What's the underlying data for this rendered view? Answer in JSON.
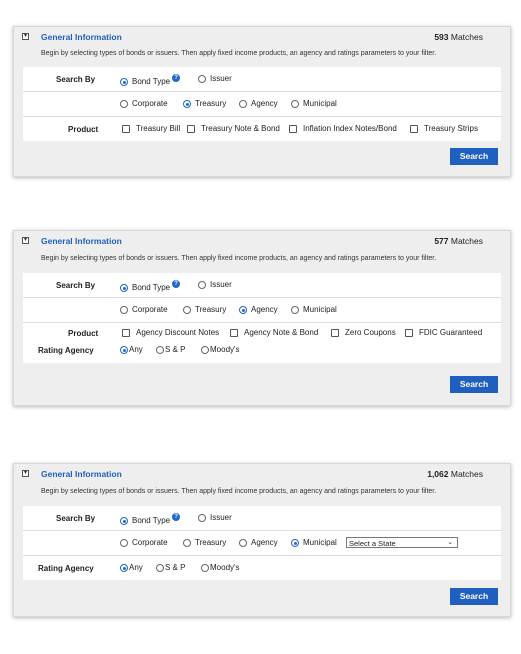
{
  "panels": [
    {
      "title": "General Information",
      "matches_count": "593",
      "matches_label": "Matches",
      "description": "Begin by selecting types of bonds or issuers. Then apply fixed income products, an agency and ratings parameters to your filter.",
      "search_by_label": "Search By",
      "search_by_options": [
        "Bond Type",
        "Issuer"
      ],
      "search_by_selected": "Bond Type",
      "help_icon": "?",
      "type_options": [
        "Corporate",
        "Treasury",
        "Agency",
        "Municipal"
      ],
      "type_selected": "Treasury",
      "product_label": "Product",
      "products": [
        "Treasury Bill",
        "Treasury Note & Bond",
        "Inflation Index Notes/Bond",
        "Treasury Strips"
      ],
      "search_button": "Search"
    },
    {
      "title": "General Information",
      "matches_count": "577",
      "matches_label": "Matches",
      "description": "Begin by selecting types of bonds or issuers. Then apply fixed income products, an agency and ratings parameters to your filter.",
      "search_by_label": "Search By",
      "search_by_options": [
        "Bond Type",
        "Issuer"
      ],
      "search_by_selected": "Bond Type",
      "help_icon": "?",
      "type_options": [
        "Corporate",
        "Treasury",
        "Agency",
        "Municipal"
      ],
      "type_selected": "Agency",
      "product_label": "Product",
      "products": [
        "Agency Discount Notes",
        "Agency Note & Bond",
        "Zero Coupons",
        "FDIC Guaranteed"
      ],
      "rating_label": "Rating Agency",
      "rating_options": [
        "Any",
        "S & P",
        "Moody's"
      ],
      "rating_selected": "Any",
      "search_button": "Search"
    },
    {
      "title": "General Information",
      "matches_count": "1,062",
      "matches_label": "Matches",
      "description": "Begin by selecting types of bonds or issuers. Then apply fixed income products, an agency and ratings parameters to your filter.",
      "search_by_label": "Search By",
      "search_by_options": [
        "Bond Type",
        "Issuer"
      ],
      "search_by_selected": "Bond Type",
      "help_icon": "?",
      "type_options": [
        "Corporate",
        "Treasury",
        "Agency",
        "Municipal"
      ],
      "type_selected": "Municipal",
      "state_select": "Select a State",
      "rating_label": "Rating Agency",
      "rating_options": [
        "Any",
        "S & P",
        "Moody's"
      ],
      "rating_selected": "Any",
      "search_button": "Search"
    }
  ]
}
